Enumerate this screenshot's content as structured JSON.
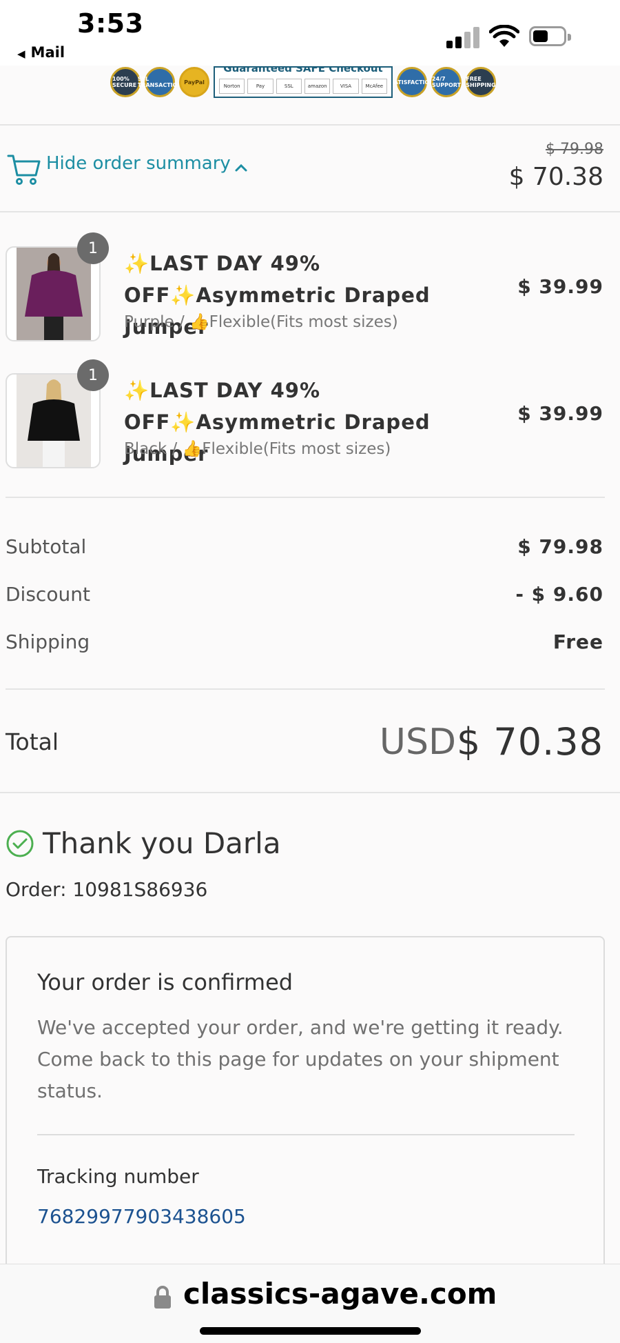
{
  "status_bar": {
    "time": "3:53",
    "back_app": "Mail"
  },
  "trust_badges": {
    "title": "Guaranteed SAFE Checkout",
    "badges": [
      "100% SECURE",
      "SSL TRANSACTION",
      "PayPal",
      "SATISFACTION",
      "24/7 SUPPORT",
      "FREE SHIPPING"
    ],
    "logos": [
      "Norton",
      "Pay",
      "SSL",
      "amazon",
      "VISA",
      "McAfee"
    ]
  },
  "summary": {
    "toggle_label": "Hide order summary",
    "original_total": "$ 79.98",
    "total": "$ 70.38"
  },
  "items": [
    {
      "quantity": "1",
      "title": "✨LAST DAY 49% OFF✨Asymmetric Draped Jumper",
      "variant": "Purple / 👍Flexible(Fits most sizes)",
      "price": "$ 39.99",
      "color": "#6a1f5c"
    },
    {
      "quantity": "1",
      "title": "✨LAST DAY 49% OFF✨Asymmetric Draped Jumper",
      "variant": "Black / 👍Flexible(Fits most sizes)",
      "price": "$ 39.99",
      "color": "#111111"
    }
  ],
  "totals": {
    "subtotal_label": "Subtotal",
    "subtotal_value": "$ 79.98",
    "discount_label": "Discount",
    "discount_value": "- $ 9.60",
    "shipping_label": "Shipping",
    "shipping_value": "Free",
    "total_label": "Total",
    "total_currency": "USD",
    "total_value": "$ 70.38"
  },
  "confirmation": {
    "thanks": "Thank you Darla",
    "order_number": "Order: 10981S86936",
    "card_title": "Your order is confirmed",
    "card_text": "We've accepted your order, and we're getting it ready. Come back to this page for updates on your shipment status.",
    "tracking_label": "Tracking number",
    "tracking_number": "76829977903438605"
  },
  "browser": {
    "url": "classics-agave.com"
  },
  "colors": {
    "accent": "#1c8ea3",
    "link": "#1c5290",
    "success": "#4caf50"
  }
}
